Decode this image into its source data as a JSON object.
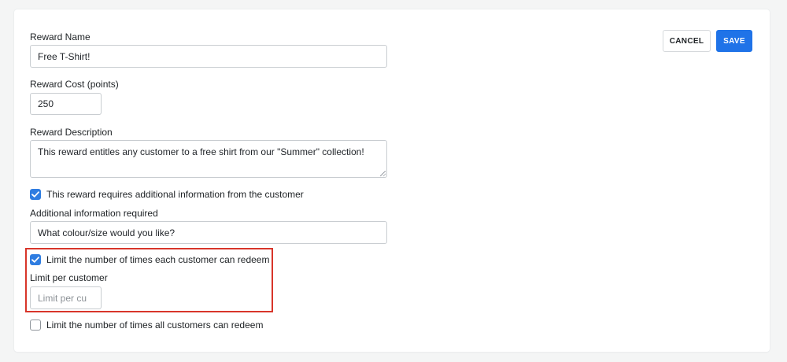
{
  "form": {
    "reward_name": {
      "label": "Reward Name",
      "value": "Free T-Shirt!"
    },
    "reward_cost": {
      "label": "Reward Cost (points)",
      "value": "250"
    },
    "reward_description": {
      "label": "Reward Description",
      "value": "This reward entitles any customer to a free shirt from our \"Summer\" collection!"
    },
    "requires_info": {
      "label": "This reward requires additional information from the customer",
      "checked": true
    },
    "additional_info": {
      "label": "Additional information required",
      "value": "What colour/size would you like?"
    },
    "limit_each_customer": {
      "label": "Limit the number of times each customer can redeem",
      "checked": true
    },
    "limit_per_customer": {
      "label": "Limit per customer",
      "value": "",
      "placeholder": "Limit per cu"
    },
    "limit_all_customers": {
      "label": "Limit the number of times all customers can redeem",
      "checked": false
    }
  },
  "actions": {
    "cancel_label": "CANCEL",
    "save_label": "SAVE"
  },
  "colors": {
    "accent": "#1f73e8",
    "checkbox": "#2f7de1",
    "highlight": "#d8352a",
    "background": "#f4f5f5"
  },
  "icons": {
    "checked_checkbox": "checkmark-icon",
    "textarea_grip": "resize-grip-icon"
  }
}
